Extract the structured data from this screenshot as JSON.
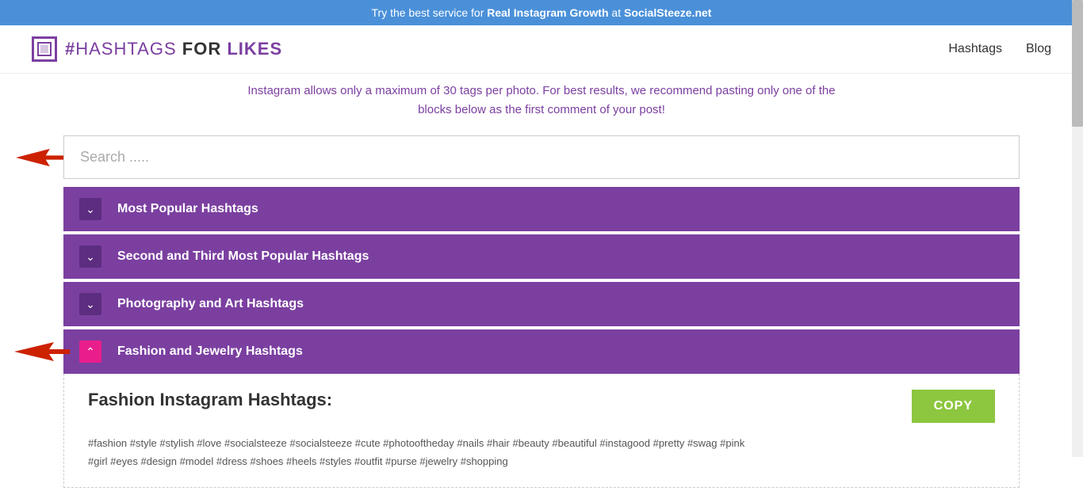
{
  "banner": {
    "text_before": "Try the best service for ",
    "highlight1": "Real Instagram Growth",
    "text_middle": " at ",
    "highlight2": "SocialSteeze.net"
  },
  "header": {
    "logo_text": "#HASHTAGS FOR LIKES",
    "nav": [
      {
        "label": "Hashtags",
        "url": "#"
      },
      {
        "label": "Blog",
        "url": "#"
      }
    ]
  },
  "info": {
    "line1": "Instagram allows only a maximum of 30 tags per photo. For best results, we recommend pasting only one of the",
    "line2": "blocks below as the first comment of your post!"
  },
  "search": {
    "placeholder": "Search ....."
  },
  "accordion": {
    "items": [
      {
        "id": "most-popular",
        "label": "Most Popular Hashtags",
        "open": false
      },
      {
        "id": "second-third",
        "label": "Second and Third Most Popular Hashtags",
        "open": false
      },
      {
        "id": "photography-art",
        "label": "Photography and Art Hashtags",
        "open": false
      },
      {
        "id": "fashion-jewelry",
        "label": "Fashion and Jewelry Hashtags",
        "open": true
      }
    ]
  },
  "fashion_content": {
    "title": "Fashion Instagram Hashtags:",
    "copy_label": "COPY",
    "hashtags_line1": "#fashion  #style  #stylish  #love  #socialsteeze  #socialsteeze  #cute  #photooftheday  #nails  #hair  #beauty  #beautiful  #instagood  #pretty  #swag  #pink",
    "hashtags_line2": "#girl  #eyes  #design  #model  #dress  #shoes  #heels  #styles  #outfit  #purse  #jewelry  #shopping"
  }
}
